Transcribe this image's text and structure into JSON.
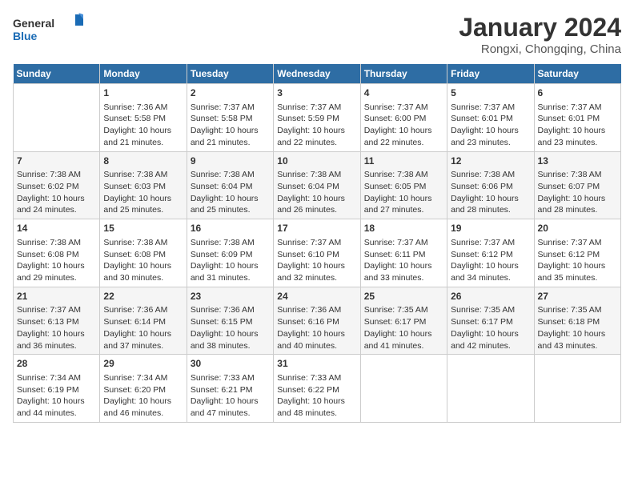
{
  "header": {
    "logo_line1": "General",
    "logo_line2": "Blue",
    "month_title": "January 2024",
    "location": "Rongxi, Chongqing, China"
  },
  "days_of_week": [
    "Sunday",
    "Monday",
    "Tuesday",
    "Wednesday",
    "Thursday",
    "Friday",
    "Saturday"
  ],
  "weeks": [
    [
      {
        "day": "",
        "info": ""
      },
      {
        "day": "1",
        "info": "Sunrise: 7:36 AM\nSunset: 5:58 PM\nDaylight: 10 hours\nand 21 minutes."
      },
      {
        "day": "2",
        "info": "Sunrise: 7:37 AM\nSunset: 5:58 PM\nDaylight: 10 hours\nand 21 minutes."
      },
      {
        "day": "3",
        "info": "Sunrise: 7:37 AM\nSunset: 5:59 PM\nDaylight: 10 hours\nand 22 minutes."
      },
      {
        "day": "4",
        "info": "Sunrise: 7:37 AM\nSunset: 6:00 PM\nDaylight: 10 hours\nand 22 minutes."
      },
      {
        "day": "5",
        "info": "Sunrise: 7:37 AM\nSunset: 6:01 PM\nDaylight: 10 hours\nand 23 minutes."
      },
      {
        "day": "6",
        "info": "Sunrise: 7:37 AM\nSunset: 6:01 PM\nDaylight: 10 hours\nand 23 minutes."
      }
    ],
    [
      {
        "day": "7",
        "info": "Sunrise: 7:38 AM\nSunset: 6:02 PM\nDaylight: 10 hours\nand 24 minutes."
      },
      {
        "day": "8",
        "info": "Sunrise: 7:38 AM\nSunset: 6:03 PM\nDaylight: 10 hours\nand 25 minutes."
      },
      {
        "day": "9",
        "info": "Sunrise: 7:38 AM\nSunset: 6:04 PM\nDaylight: 10 hours\nand 25 minutes."
      },
      {
        "day": "10",
        "info": "Sunrise: 7:38 AM\nSunset: 6:04 PM\nDaylight: 10 hours\nand 26 minutes."
      },
      {
        "day": "11",
        "info": "Sunrise: 7:38 AM\nSunset: 6:05 PM\nDaylight: 10 hours\nand 27 minutes."
      },
      {
        "day": "12",
        "info": "Sunrise: 7:38 AM\nSunset: 6:06 PM\nDaylight: 10 hours\nand 28 minutes."
      },
      {
        "day": "13",
        "info": "Sunrise: 7:38 AM\nSunset: 6:07 PM\nDaylight: 10 hours\nand 28 minutes."
      }
    ],
    [
      {
        "day": "14",
        "info": "Sunrise: 7:38 AM\nSunset: 6:08 PM\nDaylight: 10 hours\nand 29 minutes."
      },
      {
        "day": "15",
        "info": "Sunrise: 7:38 AM\nSunset: 6:08 PM\nDaylight: 10 hours\nand 30 minutes."
      },
      {
        "day": "16",
        "info": "Sunrise: 7:38 AM\nSunset: 6:09 PM\nDaylight: 10 hours\nand 31 minutes."
      },
      {
        "day": "17",
        "info": "Sunrise: 7:37 AM\nSunset: 6:10 PM\nDaylight: 10 hours\nand 32 minutes."
      },
      {
        "day": "18",
        "info": "Sunrise: 7:37 AM\nSunset: 6:11 PM\nDaylight: 10 hours\nand 33 minutes."
      },
      {
        "day": "19",
        "info": "Sunrise: 7:37 AM\nSunset: 6:12 PM\nDaylight: 10 hours\nand 34 minutes."
      },
      {
        "day": "20",
        "info": "Sunrise: 7:37 AM\nSunset: 6:12 PM\nDaylight: 10 hours\nand 35 minutes."
      }
    ],
    [
      {
        "day": "21",
        "info": "Sunrise: 7:37 AM\nSunset: 6:13 PM\nDaylight: 10 hours\nand 36 minutes."
      },
      {
        "day": "22",
        "info": "Sunrise: 7:36 AM\nSunset: 6:14 PM\nDaylight: 10 hours\nand 37 minutes."
      },
      {
        "day": "23",
        "info": "Sunrise: 7:36 AM\nSunset: 6:15 PM\nDaylight: 10 hours\nand 38 minutes."
      },
      {
        "day": "24",
        "info": "Sunrise: 7:36 AM\nSunset: 6:16 PM\nDaylight: 10 hours\nand 40 minutes."
      },
      {
        "day": "25",
        "info": "Sunrise: 7:35 AM\nSunset: 6:17 PM\nDaylight: 10 hours\nand 41 minutes."
      },
      {
        "day": "26",
        "info": "Sunrise: 7:35 AM\nSunset: 6:17 PM\nDaylight: 10 hours\nand 42 minutes."
      },
      {
        "day": "27",
        "info": "Sunrise: 7:35 AM\nSunset: 6:18 PM\nDaylight: 10 hours\nand 43 minutes."
      }
    ],
    [
      {
        "day": "28",
        "info": "Sunrise: 7:34 AM\nSunset: 6:19 PM\nDaylight: 10 hours\nand 44 minutes."
      },
      {
        "day": "29",
        "info": "Sunrise: 7:34 AM\nSunset: 6:20 PM\nDaylight: 10 hours\nand 46 minutes."
      },
      {
        "day": "30",
        "info": "Sunrise: 7:33 AM\nSunset: 6:21 PM\nDaylight: 10 hours\nand 47 minutes."
      },
      {
        "day": "31",
        "info": "Sunrise: 7:33 AM\nSunset: 6:22 PM\nDaylight: 10 hours\nand 48 minutes."
      },
      {
        "day": "",
        "info": ""
      },
      {
        "day": "",
        "info": ""
      },
      {
        "day": "",
        "info": ""
      }
    ]
  ]
}
